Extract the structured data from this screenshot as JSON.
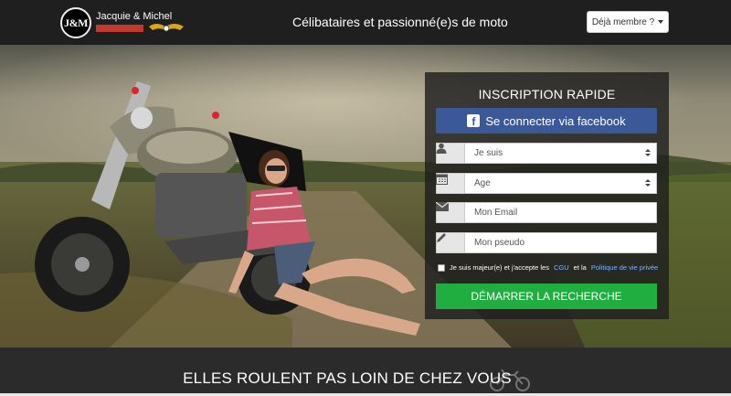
{
  "header": {
    "logo_initials": "J&M",
    "logo_name": "Jacquie & Michel",
    "tagline": "Célibataires et passionné(e)s de moto",
    "member_button": "Déjà membre ?"
  },
  "form": {
    "title": "INSCRIPTION RAPIDE",
    "facebook_label": "Se connecter via facebook",
    "facebook_icon": "f",
    "gender_select": "Je suis",
    "age_select": "Age",
    "email_placeholder": "Mon Email",
    "pseudo_placeholder": "Mon pseudo",
    "consent_prefix": "Je suis majeur(e) et j'accepte les",
    "consent_cgu": "CGU",
    "consent_middle": "et la",
    "consent_privacy": "Politique de vie privée",
    "submit_label": "DÉMARRER LA RECHERCHE"
  },
  "bottom": {
    "title": "ELLES ROULENT PAS LOIN DE CHEZ VOUS"
  },
  "icons": {
    "user": "user-icon",
    "calendar": "calendar-icon",
    "envelope": "envelope-icon",
    "pencil": "pencil-icon",
    "facebook": "facebook-icon",
    "caret": "caret-down-icon",
    "motorcycle": "motorcycle-icon"
  },
  "colors": {
    "facebook": "#3b5998",
    "submit": "#1fae3f",
    "brand_red": "#c0392b",
    "header_bg": "#1f1f1f"
  }
}
